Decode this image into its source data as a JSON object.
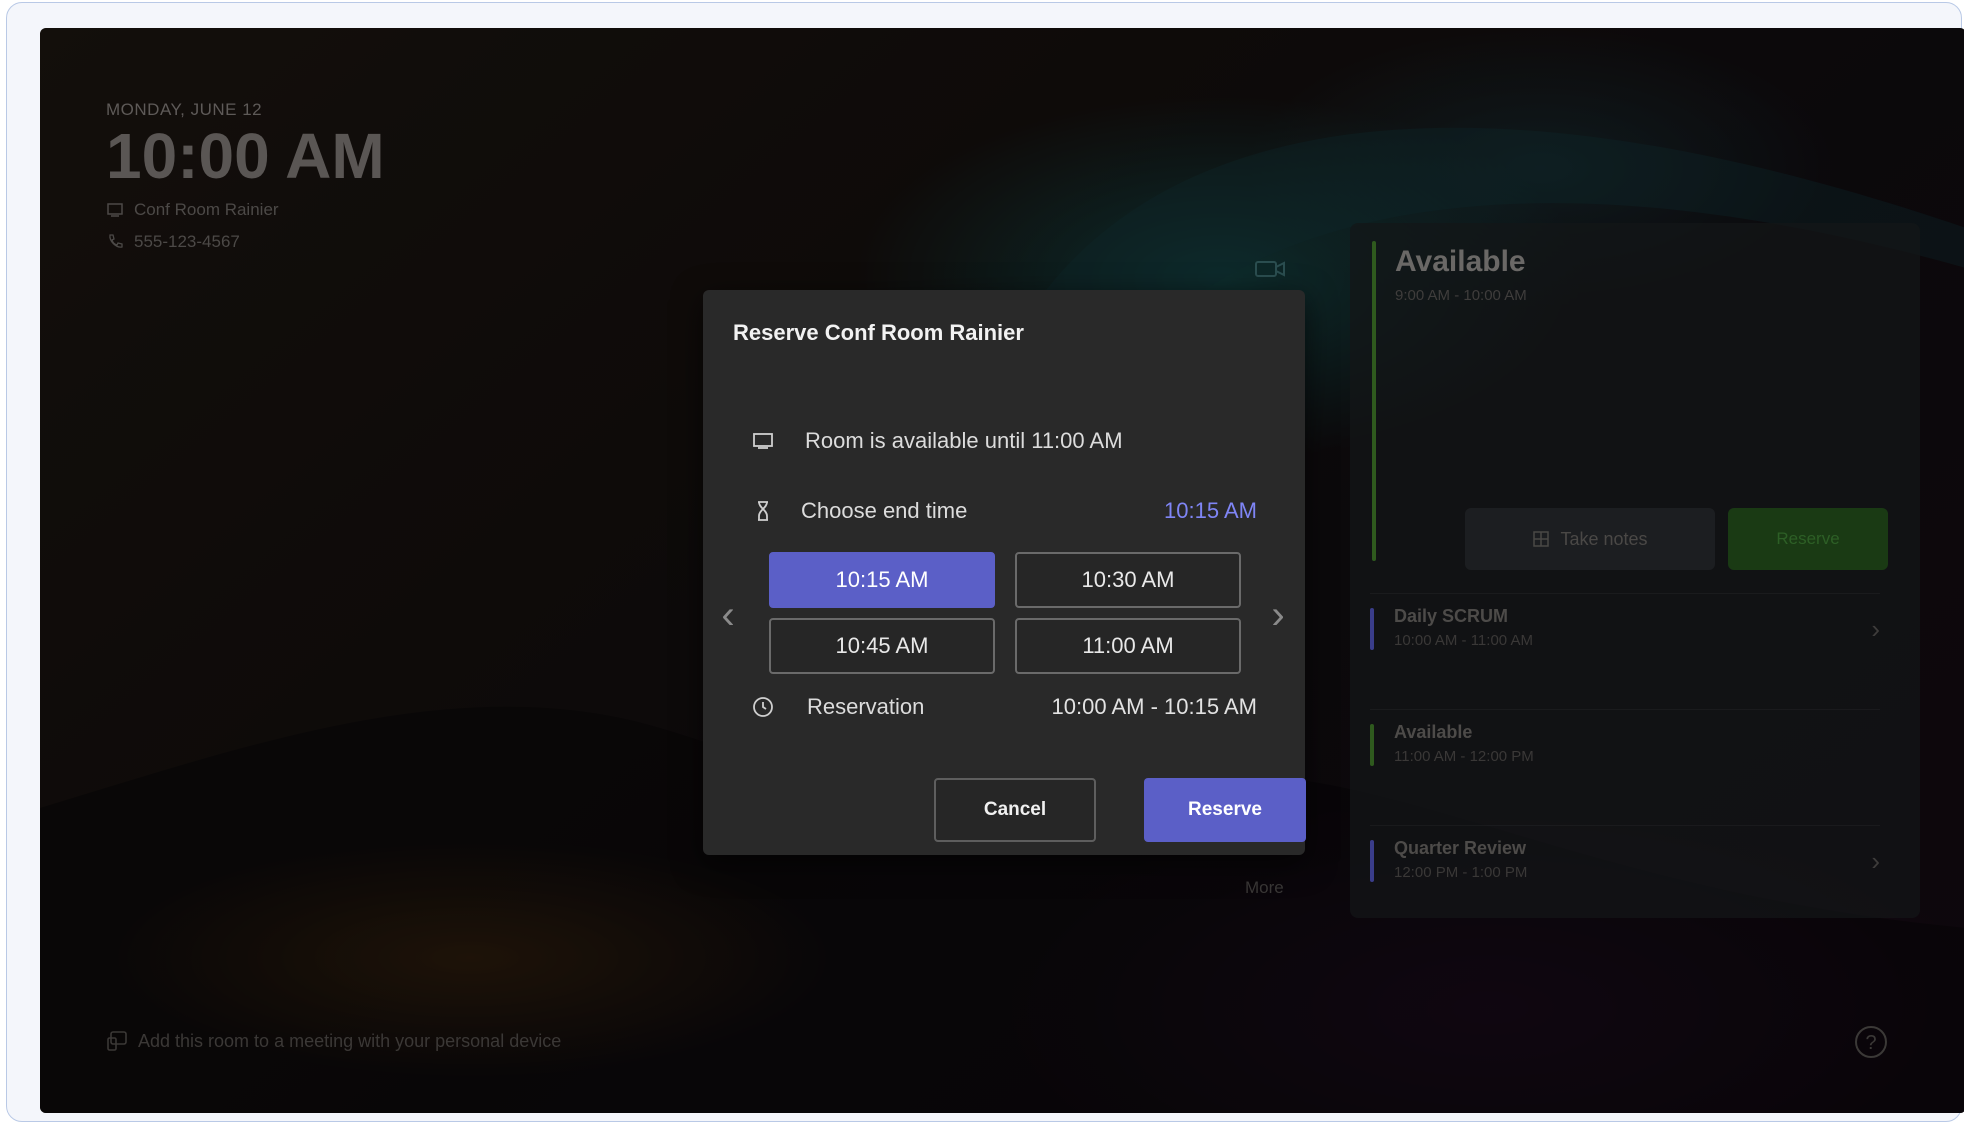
{
  "background": {
    "date": "MONDAY, JUNE 12",
    "time": "10:00 AM",
    "room_name": "Conf Room Rainier",
    "phone": "555-123-4567",
    "bottom_hint": "Add this room to a meeting with your personal device",
    "more_label": "More",
    "help_icon": "?"
  },
  "right_panel": {
    "status_title": "Available",
    "status_range": "9:00 AM - 10:00 AM",
    "take_notes_label": "Take notes",
    "reserve_label": "Reserve",
    "agenda": [
      {
        "title": "Daily SCRUM",
        "time": "10:00 AM - 11:00 AM",
        "color": "#3a3d8a"
      },
      {
        "title": "Available",
        "time": "11:00 AM - 12:00 PM",
        "color": "#2f5a1e"
      },
      {
        "title": "Quarter Review",
        "time": "12:00 PM - 1:00 PM",
        "color": "#3a3d8a"
      }
    ]
  },
  "dialog": {
    "title": "Reserve Conf Room Rainier",
    "availability_text": "Room is available until 11:00 AM",
    "choose_end_label": "Choose end time",
    "choose_end_value": "10:15 AM",
    "time_options": [
      "10:15 AM",
      "10:30 AM",
      "10:45 AM",
      "11:00 AM"
    ],
    "selected_time": "10:15 AM",
    "reservation_label": "Reservation",
    "reservation_value": "10:00 AM - 10:15 AM",
    "cancel_label": "Cancel",
    "reserve_label": "Reserve",
    "accent_color": "#5b5fc7"
  }
}
